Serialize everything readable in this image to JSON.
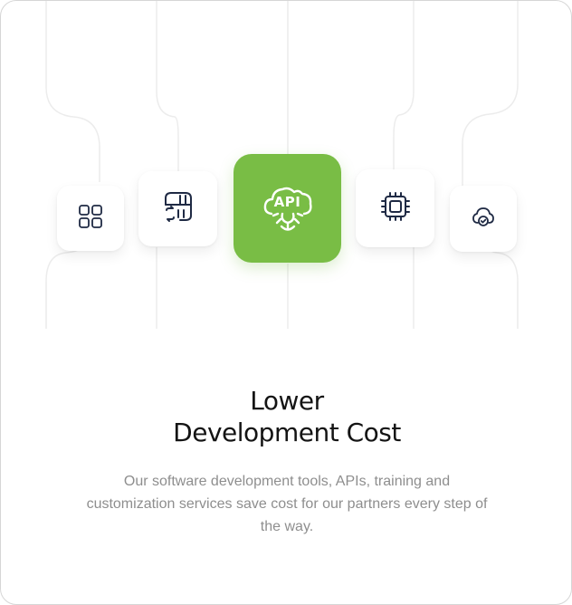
{
  "feature_card": {
    "title_line1": "Lower",
    "title_line2": "Development Cost",
    "description": "Our software development tools, APIs, training and customization services save cost for our partners every step of the way."
  },
  "icons": [
    {
      "name": "grid-icon",
      "active": false
    },
    {
      "name": "server-sync-icon",
      "active": false
    },
    {
      "name": "api-cloud-gear-icon",
      "label": "API",
      "active": true
    },
    {
      "name": "cpu-chip-icon",
      "active": false
    },
    {
      "name": "cloud-check-icon",
      "active": false
    }
  ],
  "colors": {
    "accent": "#79bd45",
    "icon_stroke": "#1f2a44",
    "title": "#141414",
    "description": "#8e8e8e",
    "guide_lines": "#ececec"
  }
}
